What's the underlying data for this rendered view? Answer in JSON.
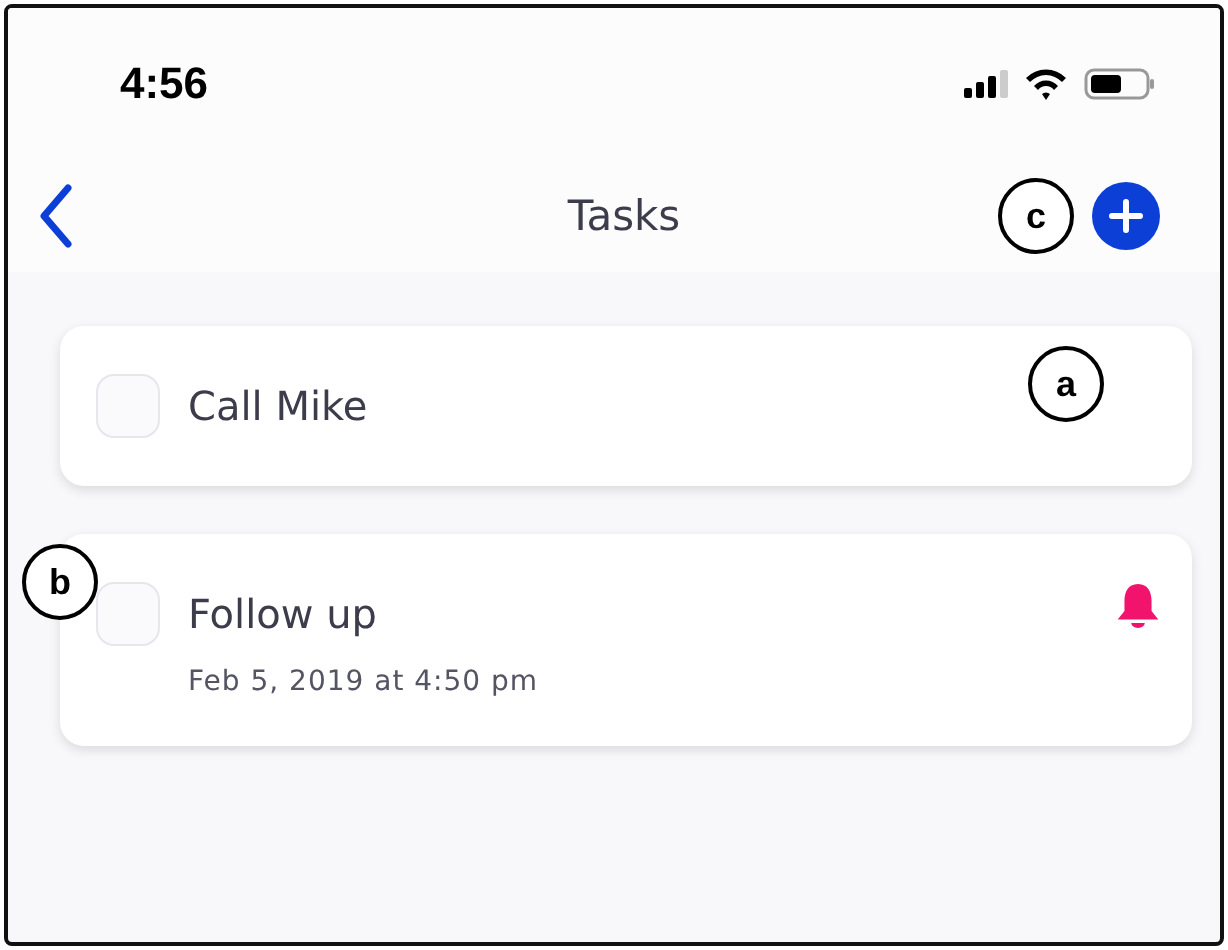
{
  "status_bar": {
    "time": "4:56"
  },
  "nav": {
    "title": "Tasks",
    "callout": "c"
  },
  "tasks": [
    {
      "title": "Call Mike",
      "checked": false,
      "reminder": false,
      "callout": "a"
    },
    {
      "title": "Follow up",
      "due": "Feb 5, 2019 at 4:50 pm",
      "checked": false,
      "reminder": true,
      "callout": "b"
    }
  ]
}
